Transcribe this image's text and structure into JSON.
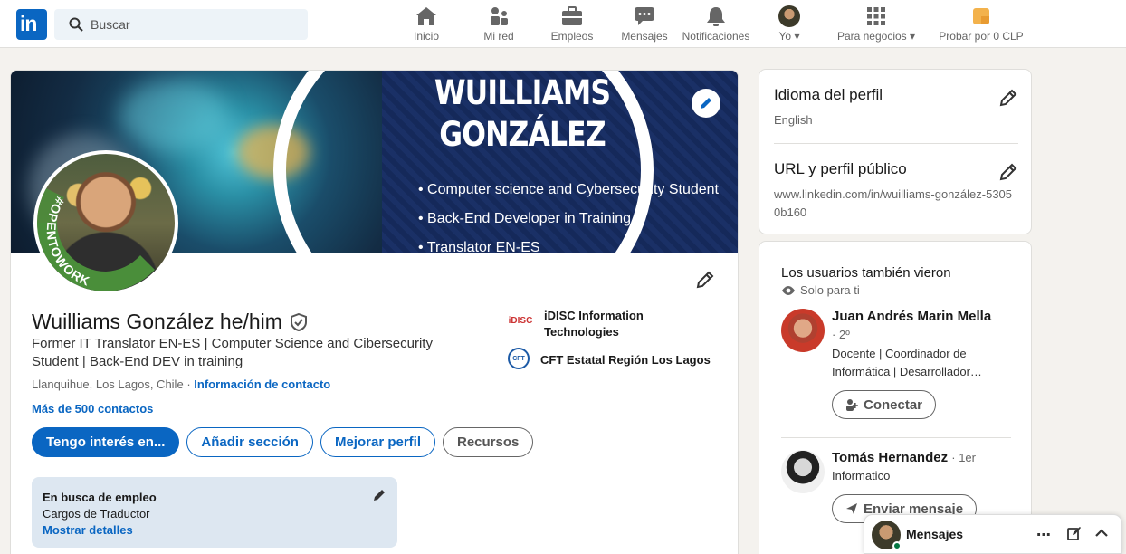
{
  "nav": {
    "search_placeholder": "Buscar",
    "items": [
      {
        "label": "Inicio",
        "icon": "home-icon"
      },
      {
        "label": "Mi red",
        "icon": "network-icon"
      },
      {
        "label": "Empleos",
        "icon": "briefcase-icon"
      },
      {
        "label": "Mensajes",
        "icon": "messaging-icon"
      },
      {
        "label": "Notificaciones",
        "icon": "bell-icon"
      },
      {
        "label": "Yo",
        "icon": "user-avatar"
      }
    ],
    "business_label": "Para negocios",
    "premium_label": "Probar por 0 CLP"
  },
  "banner": {
    "name_line1": "WUILLIAMS",
    "name_line2": "GONZÁLEZ",
    "bullets": [
      "• Computer science and Cybersecurity Student",
      "• Back-End Developer in Training",
      "• Translator EN-ES"
    ],
    "open_to_work": "#OPENTOWORK"
  },
  "profile": {
    "name": "Wuilliams González he/him",
    "headline": "Former IT Translator EN-ES | Computer Science and Cibersecurity Student | Back-End DEV in training",
    "location": "Llanquihue, Los Lagos, Chile",
    "location_sep": "·",
    "contact_info": "Información de contacto",
    "connections": "Más de 500 contactos",
    "experience": [
      {
        "logo_text": "iDISC",
        "name": "iDISC Information Technologies"
      },
      {
        "logo_text": "CFT",
        "name": "CFT Estatal Región Los Lagos"
      }
    ],
    "buttons": {
      "open_to": "Tengo interés en...",
      "add_section": "Añadir sección",
      "improve": "Mejorar perfil",
      "resources": "Recursos"
    },
    "open_to_work_box": {
      "title": "En busca de empleo",
      "roles": "Cargos de Traductor",
      "details": "Mostrar detalles"
    }
  },
  "sidebar": {
    "language_title": "Idioma del perfil",
    "language_value": "English",
    "url_title": "URL y perfil público",
    "url_value": "www.linkedin.com/in/wuilliams-gonzález-53050b160",
    "pav_title": "Los usuarios también vieron",
    "pav_sub": "Solo para ti",
    "people": [
      {
        "name": "Juan Andrés Marin Mella",
        "degree": "· 2º",
        "desc": "Docente | Coordinador de Informática | Desarrollador…",
        "action": "Conectar"
      },
      {
        "name": "Tomás Hernandez",
        "degree": "· 1er",
        "desc": "Informatico",
        "action": "Enviar mensaje"
      }
    ]
  },
  "messaging": {
    "title": "Mensajes"
  },
  "colors": {
    "brand": "#0a66c2",
    "otw_green": "#4a8e3a",
    "background": "#f4f2ee"
  }
}
